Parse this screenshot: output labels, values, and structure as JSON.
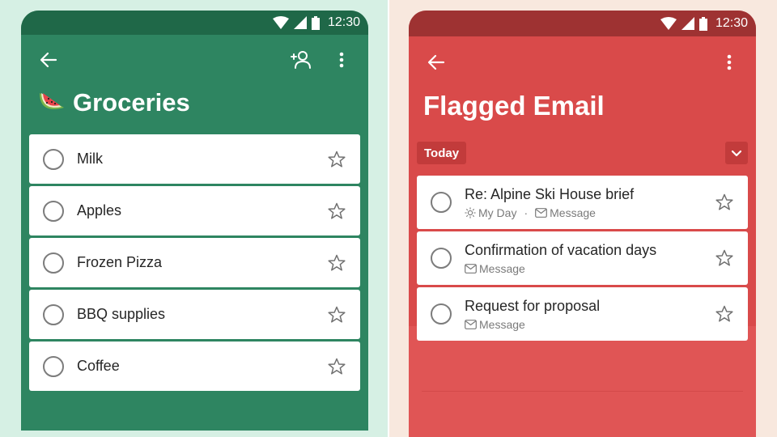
{
  "left": {
    "background_color": "#d6f0e4",
    "theme_color": "#2e8561",
    "status_bar": {
      "time": "12:30"
    },
    "list_emoji": "🍉",
    "title": "Groceries",
    "tasks": [
      {
        "label": "Milk",
        "completed": false,
        "important": false
      },
      {
        "label": "Apples",
        "completed": false,
        "important": false
      },
      {
        "label": "Frozen Pizza",
        "completed": false,
        "important": false
      },
      {
        "label": "BBQ supplies",
        "completed": false,
        "important": false
      },
      {
        "label": "Coffee",
        "completed": false,
        "important": false
      }
    ],
    "icons": [
      "back-arrow-icon",
      "add-person-icon",
      "more-vertical-icon"
    ]
  },
  "right": {
    "background_color": "#f8e8de",
    "theme_color": "#d94a4a",
    "status_bar": {
      "time": "12:30"
    },
    "title": "Flagged Email",
    "section": {
      "label": "Today"
    },
    "tasks": [
      {
        "label": "Re: Alpine Ski House brief",
        "my_day": "My Day",
        "separator": "·",
        "source": "Message",
        "completed": false,
        "important": false
      },
      {
        "label": "Confirmation of vacation days",
        "source": "Message",
        "completed": false,
        "important": false
      },
      {
        "label": "Request for proposal",
        "source": "Message",
        "completed": false,
        "important": false
      }
    ],
    "icons": [
      "back-arrow-icon",
      "more-vertical-icon",
      "chevron-down-icon"
    ]
  }
}
